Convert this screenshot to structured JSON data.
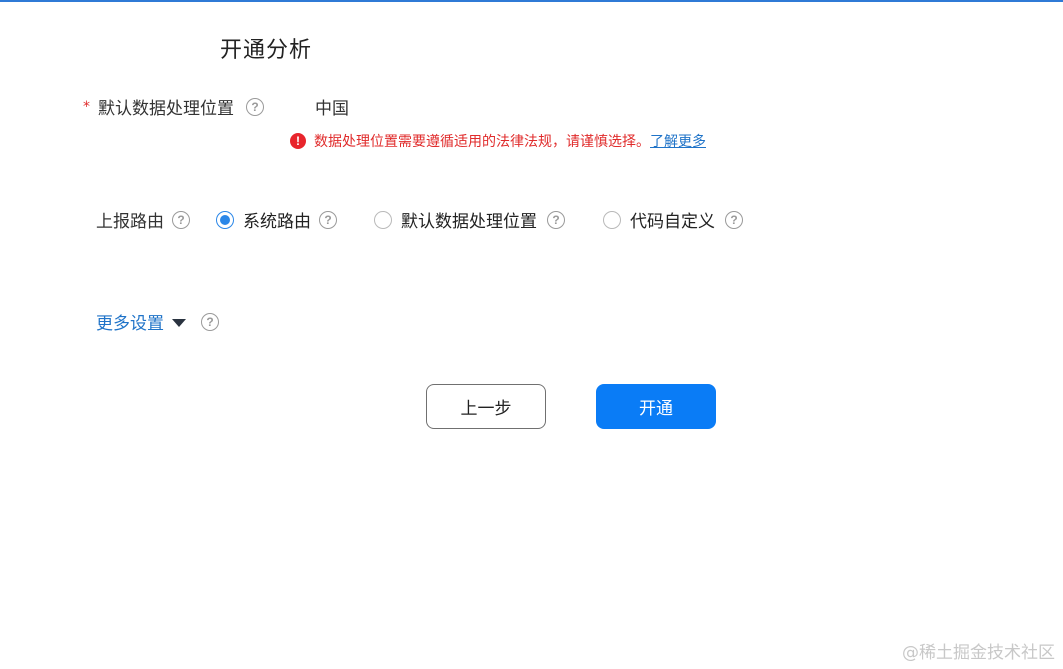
{
  "page": {
    "title": "开通分析"
  },
  "location": {
    "label": "默认数据处理位置",
    "value": "中国",
    "required_mark": "*",
    "warning_text": "数据处理位置需要遵循适用的法律法规，请谨慎选择。",
    "warning_link": "了解更多"
  },
  "routing": {
    "label": "上报路由",
    "options": [
      {
        "label": "系统路由",
        "selected": true
      },
      {
        "label": "默认数据处理位置",
        "selected": false
      },
      {
        "label": "代码自定义",
        "selected": false
      }
    ]
  },
  "more_settings": {
    "label": "更多设置"
  },
  "buttons": {
    "prev": "上一步",
    "open": "开通"
  },
  "help_glyph": "?",
  "warn_glyph": "!",
  "watermark": "@稀土掘金技术社区",
  "colors": {
    "accent": "#0a7cf6",
    "link": "#1f73c8",
    "error": "#e02b2b",
    "radio_checked": "#2b87e8"
  },
  "icons": [
    "help-icon",
    "warning-icon",
    "caret-down-icon"
  ]
}
